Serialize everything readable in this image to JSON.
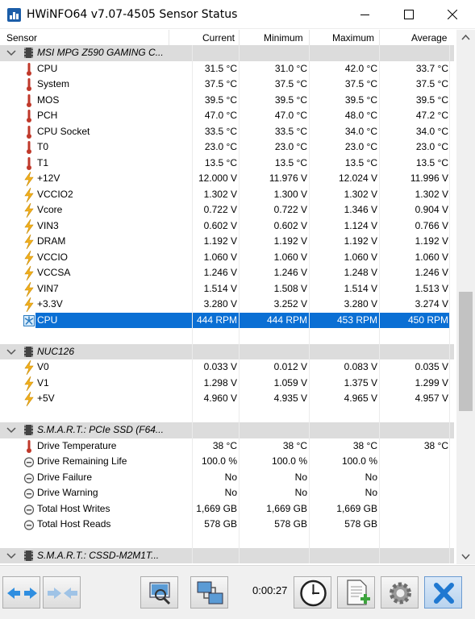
{
  "window": {
    "title": "HWiNFO64 v7.07-4505 Sensor Status"
  },
  "columns": {
    "sensor": "Sensor",
    "current": "Current",
    "minimum": "Minimum",
    "maximum": "Maximum",
    "average": "Average"
  },
  "rows": [
    {
      "type": "group",
      "name": "MSI MPG Z590 GAMING C..."
    },
    {
      "type": "temp",
      "name": "CPU",
      "cur": "31.5 °C",
      "min": "31.0 °C",
      "max": "42.0 °C",
      "avg": "33.7 °C"
    },
    {
      "type": "temp",
      "name": "System",
      "cur": "37.5 °C",
      "min": "37.5 °C",
      "max": "37.5 °C",
      "avg": "37.5 °C"
    },
    {
      "type": "temp",
      "name": "MOS",
      "cur": "39.5 °C",
      "min": "39.5 °C",
      "max": "39.5 °C",
      "avg": "39.5 °C"
    },
    {
      "type": "temp",
      "name": "PCH",
      "cur": "47.0 °C",
      "min": "47.0 °C",
      "max": "48.0 °C",
      "avg": "47.2 °C"
    },
    {
      "type": "temp",
      "name": "CPU Socket",
      "cur": "33.5 °C",
      "min": "33.5 °C",
      "max": "34.0 °C",
      "avg": "34.0 °C"
    },
    {
      "type": "temp",
      "name": "T0",
      "cur": "23.0 °C",
      "min": "23.0 °C",
      "max": "23.0 °C",
      "avg": "23.0 °C"
    },
    {
      "type": "temp",
      "name": "T1",
      "cur": "13.5 °C",
      "min": "13.5 °C",
      "max": "13.5 °C",
      "avg": "13.5 °C"
    },
    {
      "type": "volt",
      "name": "+12V",
      "cur": "12.000 V",
      "min": "11.976 V",
      "max": "12.024 V",
      "avg": "11.996 V"
    },
    {
      "type": "volt",
      "name": "VCCIO2",
      "cur": "1.302 V",
      "min": "1.300 V",
      "max": "1.302 V",
      "avg": "1.302 V"
    },
    {
      "type": "volt",
      "name": "Vcore",
      "cur": "0.722 V",
      "min": "0.722 V",
      "max": "1.346 V",
      "avg": "0.904 V"
    },
    {
      "type": "volt",
      "name": "VIN3",
      "cur": "0.602 V",
      "min": "0.602 V",
      "max": "1.124 V",
      "avg": "0.766 V"
    },
    {
      "type": "volt",
      "name": "DRAM",
      "cur": "1.192 V",
      "min": "1.192 V",
      "max": "1.192 V",
      "avg": "1.192 V"
    },
    {
      "type": "volt",
      "name": "VCCIO",
      "cur": "1.060 V",
      "min": "1.060 V",
      "max": "1.060 V",
      "avg": "1.060 V"
    },
    {
      "type": "volt",
      "name": "VCCSA",
      "cur": "1.246 V",
      "min": "1.246 V",
      "max": "1.248 V",
      "avg": "1.246 V"
    },
    {
      "type": "volt",
      "name": "VIN7",
      "cur": "1.514 V",
      "min": "1.508 V",
      "max": "1.514 V",
      "avg": "1.513 V"
    },
    {
      "type": "volt",
      "name": "+3.3V",
      "cur": "3.280 V",
      "min": "3.252 V",
      "max": "3.280 V",
      "avg": "3.274 V"
    },
    {
      "type": "fan",
      "name": "CPU",
      "cur": "444 RPM",
      "min": "444 RPM",
      "max": "453 RPM",
      "avg": "450 RPM",
      "selected": true
    },
    {
      "type": "blank"
    },
    {
      "type": "group",
      "name": "NUC126"
    },
    {
      "type": "volt",
      "name": "V0",
      "cur": "0.033 V",
      "min": "0.012 V",
      "max": "0.083 V",
      "avg": "0.035 V"
    },
    {
      "type": "volt",
      "name": "V1",
      "cur": "1.298 V",
      "min": "1.059 V",
      "max": "1.375 V",
      "avg": "1.299 V"
    },
    {
      "type": "volt",
      "name": "+5V",
      "cur": "4.960 V",
      "min": "4.935 V",
      "max": "4.965 V",
      "avg": "4.957 V"
    },
    {
      "type": "blank"
    },
    {
      "type": "group",
      "name": "S.M.A.R.T.: PCIe SSD (F64..."
    },
    {
      "type": "temp",
      "name": "Drive Temperature",
      "cur": "38 °C",
      "min": "38 °C",
      "max": "38 °C",
      "avg": "38 °C"
    },
    {
      "type": "status",
      "name": "Drive Remaining Life",
      "cur": "100.0 %",
      "min": "100.0 %",
      "max": "100.0 %",
      "avg": ""
    },
    {
      "type": "status",
      "name": "Drive Failure",
      "cur": "No",
      "min": "No",
      "max": "No",
      "avg": ""
    },
    {
      "type": "status",
      "name": "Drive Warning",
      "cur": "No",
      "min": "No",
      "max": "No",
      "avg": ""
    },
    {
      "type": "status",
      "name": "Total Host Writes",
      "cur": "1,669 GB",
      "min": "1,669 GB",
      "max": "1,669 GB",
      "avg": ""
    },
    {
      "type": "status",
      "name": "Total Host Reads",
      "cur": "578 GB",
      "min": "578 GB",
      "max": "578 GB",
      "avg": ""
    },
    {
      "type": "blank"
    },
    {
      "type": "group",
      "name": "S.M.A.R.T.: CSSD-M2M1T..."
    }
  ],
  "toolbar": {
    "timer": "0:00:27",
    "buttons": [
      "expand-arrows",
      "collapse-arrows",
      "report",
      "network",
      "clock",
      "logging",
      "settings",
      "close"
    ]
  },
  "colors": {
    "selection": "#0a6fd4",
    "group_bg": "#dcdcdc",
    "temp_icon": "#c0392b",
    "volt_icon": "#f2b01e",
    "close_button": "#1f78d1"
  }
}
